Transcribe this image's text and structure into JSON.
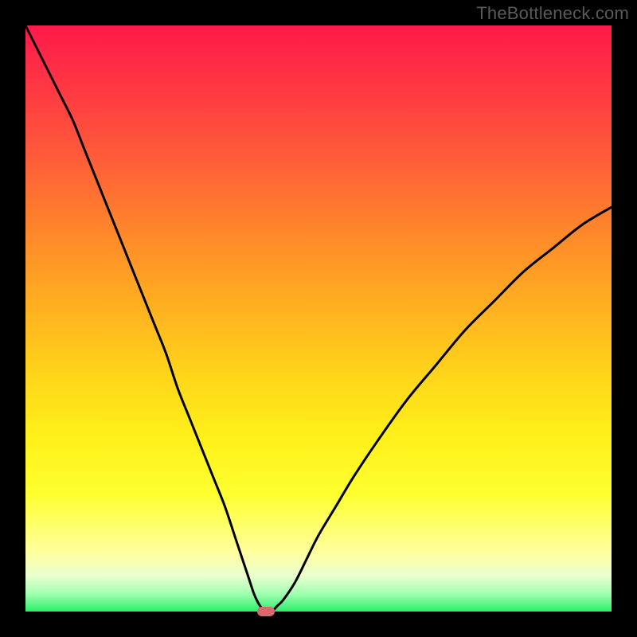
{
  "watermark": "TheBottleneck.com",
  "colors": {
    "top": "#ff1a4a",
    "mid": "#ffd61a",
    "bottom": "#2aef6a",
    "curve": "#000000",
    "marker": "#d66a6a",
    "frame": "#000000"
  },
  "chart_data": {
    "type": "line",
    "title": "",
    "xlabel": "",
    "ylabel": "",
    "xlim": [
      0,
      100
    ],
    "ylim": [
      0,
      100
    ],
    "grid": false,
    "legend": false,
    "curve_description": "V-shaped bottleneck curve; left branch steep descent from top-left to a near-zero minimum around x≈41, right branch slower rise toward top-right; vertical axis encodes bottleneck percentage, horizontal axis encodes component balance.",
    "x": [
      0,
      2,
      4,
      6,
      8,
      10,
      12,
      14,
      16,
      18,
      20,
      22,
      24,
      26,
      28,
      30,
      32,
      34,
      36,
      38,
      39,
      40,
      41,
      42,
      43,
      44,
      46,
      48,
      50,
      53,
      56,
      60,
      65,
      70,
      75,
      80,
      85,
      90,
      95,
      100
    ],
    "y": [
      100,
      96,
      92,
      88,
      84,
      79,
      74,
      69,
      64,
      59,
      54,
      49,
      44,
      38,
      33,
      28,
      23,
      18,
      12,
      6,
      3,
      1,
      0,
      0,
      1,
      2,
      5,
      9,
      13,
      18,
      23,
      29,
      36,
      42,
      48,
      53,
      58,
      62,
      66,
      69
    ],
    "marker": {
      "x": 41,
      "y": 0
    }
  }
}
